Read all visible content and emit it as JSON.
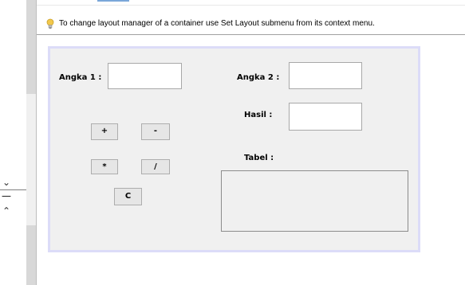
{
  "hint": {
    "text": "To change layout manager of a container use Set Layout submenu from its context menu."
  },
  "left_gutter": {
    "minus_symbol": "—",
    "down_arrow": "⌄",
    "up_arrow": "⌃"
  },
  "form": {
    "angka1_label": "Angka 1 :",
    "angka1_value": "",
    "angka2_label": "Angka 2 :",
    "angka2_value": "",
    "hasil_label": "Hasil :",
    "hasil_value": "",
    "tabel_label": "Tabel :",
    "buttons": {
      "plus": "+",
      "minus": "-",
      "multiply": "*",
      "divide": "/",
      "clear": "C"
    }
  },
  "colors": {
    "panel_bg": "#f0f0f0",
    "panel_border": "#dcdcf8",
    "hint_bulb": "#f2c84b"
  }
}
